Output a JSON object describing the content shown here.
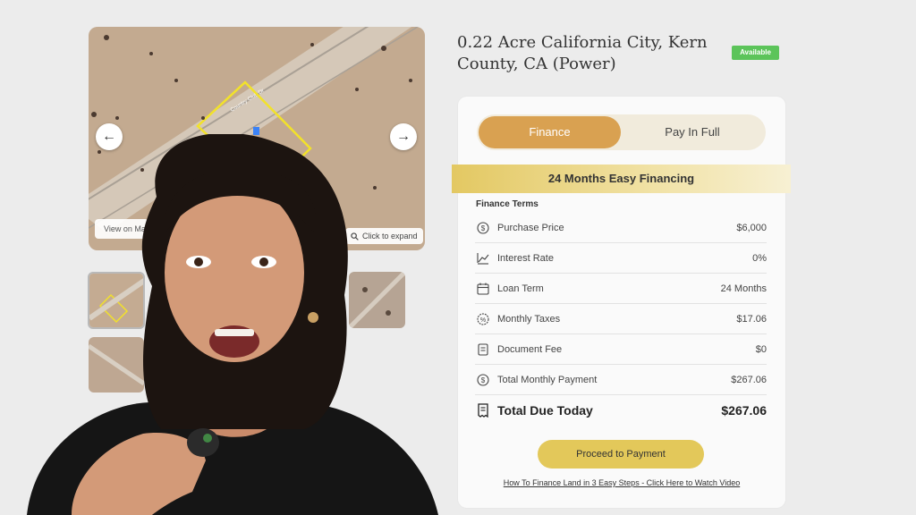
{
  "listing": {
    "title": "0.22 Acre California City, Kern County, CA (Power)",
    "status_badge": "Available"
  },
  "gallery": {
    "view_map_label": "View on Map",
    "expand_label": "Click to expand",
    "road_label": "Country Club Dr",
    "prev_icon": "arrow-left-icon",
    "next_icon": "arrow-right-icon"
  },
  "payment_toggle": {
    "finance_label": "Finance",
    "pay_full_label": "Pay In Full",
    "active": "Finance"
  },
  "financing": {
    "banner": "24 Months Easy Financing",
    "terms_heading": "Finance Terms",
    "rows": [
      {
        "icon": "dollar-circle-icon",
        "label": "Purchase Price",
        "value": "$6,000"
      },
      {
        "icon": "trend-line-icon",
        "label": "Interest Rate",
        "value": "0%"
      },
      {
        "icon": "calendar-icon",
        "label": "Loan Term",
        "value": "24 Months"
      },
      {
        "icon": "tax-badge-icon",
        "label": "Monthly Taxes",
        "value": "$17.06"
      },
      {
        "icon": "document-icon",
        "label": "Document Fee",
        "value": "$0"
      },
      {
        "icon": "dollar-circle-icon",
        "label": "Total Monthly Payment",
        "value": "$267.06"
      }
    ],
    "total": {
      "icon": "receipt-icon",
      "label": "Total Due Today",
      "value": "$267.06"
    }
  },
  "actions": {
    "proceed_label": "Proceed to Payment",
    "video_link": "How To Finance Land in 3 Easy Steps - Click Here to Watch Video"
  },
  "colors": {
    "finance_active": "#d9a151",
    "banner": "#e3c862",
    "pay_button": "#e3c85a",
    "badge": "#5cc45a",
    "parcel_outline": "#f2e22a"
  }
}
